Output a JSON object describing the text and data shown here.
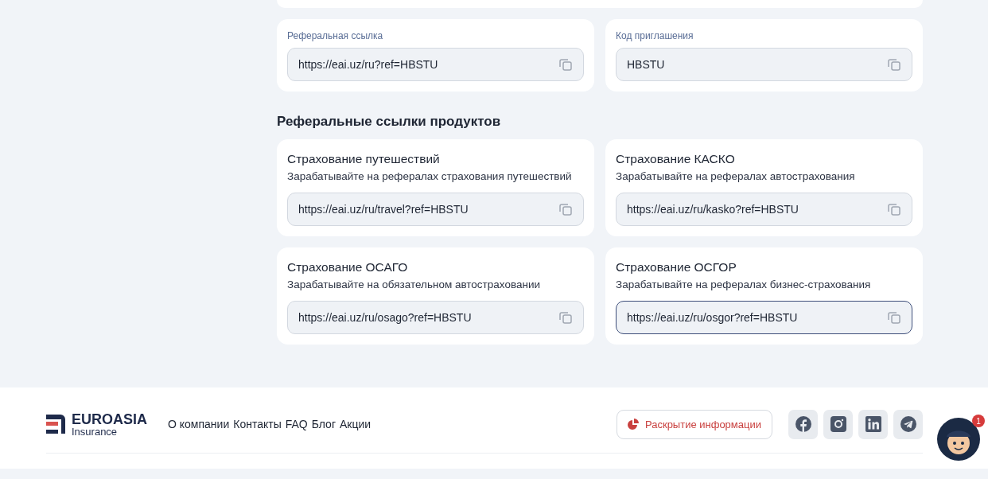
{
  "referral": [
    {
      "label": "Реферальная ссылка",
      "value": "https://eai.uz/ru?ref=HBSTU"
    },
    {
      "label": "Код приглашения",
      "value": "HBSTU"
    }
  ],
  "products_heading": "Реферальные ссылки продуктов",
  "products": [
    {
      "title": "Страхование путешествий",
      "subtitle": "Зарабатывайте на рефералах страхования путешествий",
      "link": "https://eai.uz/ru/travel?ref=HBSTU",
      "focused": false
    },
    {
      "title": "Страхование КАСКО",
      "subtitle": "Зарабатывайте на рефералах автострахования",
      "link": "https://eai.uz/ru/kasko?ref=HBSTU",
      "focused": false
    },
    {
      "title": "Страхование ОСАГО",
      "subtitle": "Зарабатывайте на обязательном автостраховании",
      "link": "https://eai.uz/ru/osago?ref=HBSTU",
      "focused": false
    },
    {
      "title": "Страхование ОСГОР",
      "subtitle": "Зарабатывайте на рефералах бизнес-страхования",
      "link": "https://eai.uz/ru/osgor?ref=HBSTU",
      "focused": true
    }
  ],
  "footer": {
    "logo": {
      "name": "EUROASIA",
      "sub": "Insurance"
    },
    "links": [
      "О компании",
      "Контакты",
      "FAQ",
      "Блог",
      "Акции"
    ],
    "disclosure_button": "Раскрытие информации",
    "socials": [
      {
        "kind": "facebook"
      },
      {
        "kind": "instagram"
      },
      {
        "kind": "linkedin"
      },
      {
        "kind": "telegram"
      }
    ],
    "chat": {
      "badge": "1"
    }
  }
}
